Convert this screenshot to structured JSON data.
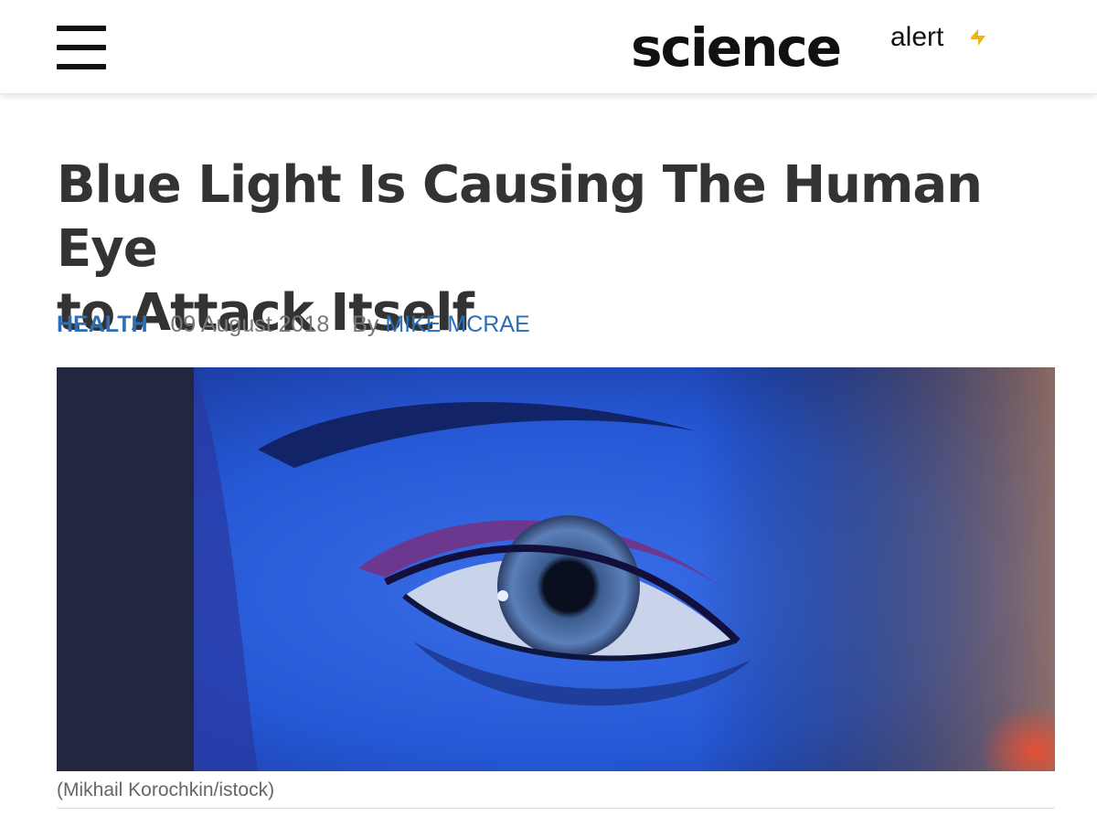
{
  "header": {
    "menu_icon": "hamburger-menu-icon",
    "logo": {
      "science": "science",
      "alert": "alert",
      "mark_color": "#f2b21b"
    }
  },
  "article": {
    "title_line1": "Blue Light Is Causing The Human Eye",
    "title_line2": "to Attack Itself",
    "category": "HEALTH",
    "date": "09 August 2018",
    "by": "By",
    "author": "MIKE MCRAE",
    "image_caption": "(Mikhail Korochkin/istock)"
  },
  "colors": {
    "link": "#2d6fb6",
    "meta": "#777777",
    "title": "#333333"
  }
}
